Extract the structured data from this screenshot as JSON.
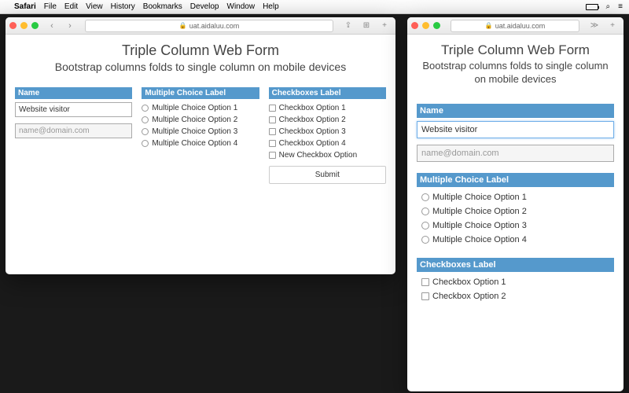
{
  "menubar": {
    "app": "Safari",
    "items": [
      "File",
      "Edit",
      "View",
      "History",
      "Bookmarks",
      "Develop",
      "Window",
      "Help"
    ]
  },
  "address": "uat.aidaluu.com",
  "page": {
    "title": "Triple Column Web Form",
    "subtitle": "Bootstrap columns folds to single column on mobile devices"
  },
  "form": {
    "name_label": "Name",
    "name_value": "Website visitor",
    "email_placeholder": "name@domain.com",
    "mc_label": "Multiple Choice Label",
    "mc_options": [
      "Multiple Choice Option 1",
      "Multiple Choice Option 2",
      "Multiple Choice Option 3",
      "Multiple Choice Option 4"
    ],
    "cb_label": "Checkboxes Label",
    "cb_options": [
      "Checkbox Option 1",
      "Checkbox Option 2",
      "Checkbox Option 3",
      "Checkbox Option 4",
      "New Checkbox Option"
    ],
    "cb_options_visible": [
      "Checkbox Option 1",
      "Checkbox Option 2"
    ],
    "submit": "Submit"
  }
}
